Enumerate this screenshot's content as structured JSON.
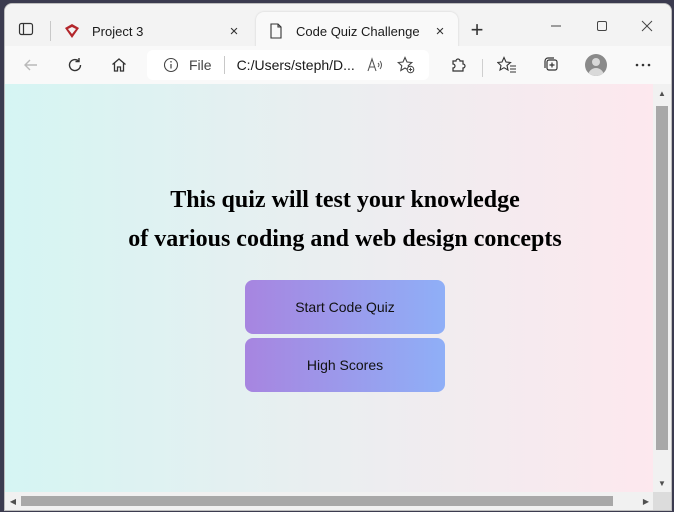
{
  "tabs": [
    {
      "label": "Project 3",
      "close": "×"
    },
    {
      "label": "Code Quiz Challenge",
      "close": "×"
    }
  ],
  "new_tab": "+",
  "address": {
    "scheme": "File",
    "url": "C:/Users/steph/D..."
  },
  "page": {
    "heading_line1": "This quiz will test your knowledge",
    "heading_line2": "of various coding and web design concepts",
    "start_button": "Start Code Quiz",
    "scores_button": "High Scores"
  },
  "scroll": {
    "up": "▲",
    "down": "▼",
    "left": "◀",
    "right": "▶"
  },
  "colors": {
    "bg_left": "#d5f5f3",
    "bg_right": "#fde8ee",
    "button_left": "#a785e0",
    "button_right": "#8faff7"
  },
  "icons": [
    "tab-actions-icon",
    "project-favicon",
    "page-icon",
    "back-icon",
    "refresh-icon",
    "home-icon",
    "info-icon",
    "read-aloud-icon",
    "add-favorite-icon",
    "extensions-icon",
    "favorites-icon",
    "collections-icon",
    "profile-avatar",
    "more-icon",
    "minimize-icon",
    "maximize-icon",
    "close-window-icon"
  ]
}
